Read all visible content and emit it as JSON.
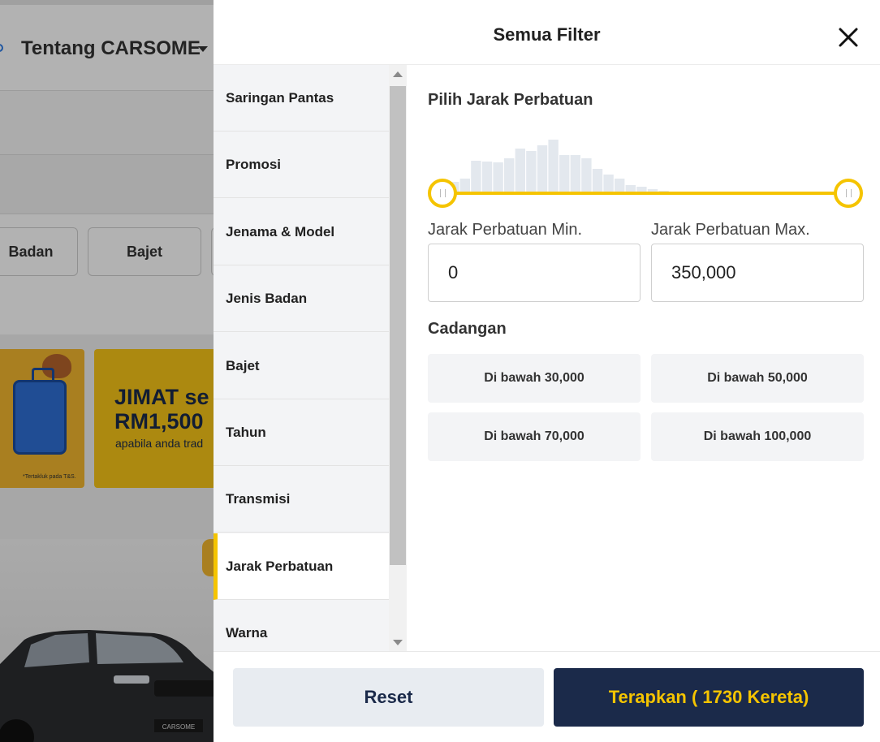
{
  "background": {
    "nav_about": "Tentang CARSOME",
    "chips": [
      "Badan",
      "Bajet"
    ],
    "banner_headline_1": "JIMAT se",
    "banner_headline_2": "RM1,500",
    "banner_sub": "apabila anda trad",
    "banner_tnc": "*Tertakluk pada T&S.",
    "car_plate": "CARSOME"
  },
  "modal": {
    "title": "Semua Filter",
    "nav_items": [
      {
        "label": "Saringan Pantas"
      },
      {
        "label": "Promosi"
      },
      {
        "label": "Jenama & Model"
      },
      {
        "label": "Jenis Badan"
      },
      {
        "label": "Bajet"
      },
      {
        "label": "Tahun"
      },
      {
        "label": "Transmisi"
      },
      {
        "label": "Jarak Perbatuan",
        "active": true
      },
      {
        "label": "Warna"
      }
    ],
    "section_title": "Pilih Jarak Perbatuan",
    "histogram_bars": [
      14,
      18,
      40,
      39,
      38,
      43,
      55,
      52,
      59,
      66,
      47,
      47,
      43,
      30,
      23,
      18,
      10,
      8,
      5,
      3,
      2,
      1,
      1,
      0,
      1,
      0,
      0,
      0,
      0,
      0,
      0,
      0,
      0,
      0,
      0
    ],
    "min_label": "Jarak Perbatuan Min.",
    "max_label": "Jarak Perbatuan Max.",
    "min_value": "0",
    "max_value": "350,000",
    "suggestions_title": "Cadangan",
    "suggestions": [
      "Di bawah 30,000",
      "Di bawah 50,000",
      "Di bawah 70,000",
      "Di bawah 100,000"
    ],
    "reset_label": "Reset",
    "apply_label": "Terapkan ( 1730 Kereta)",
    "accent_color": "#f5c400",
    "primary_color": "#1b2a4a"
  }
}
